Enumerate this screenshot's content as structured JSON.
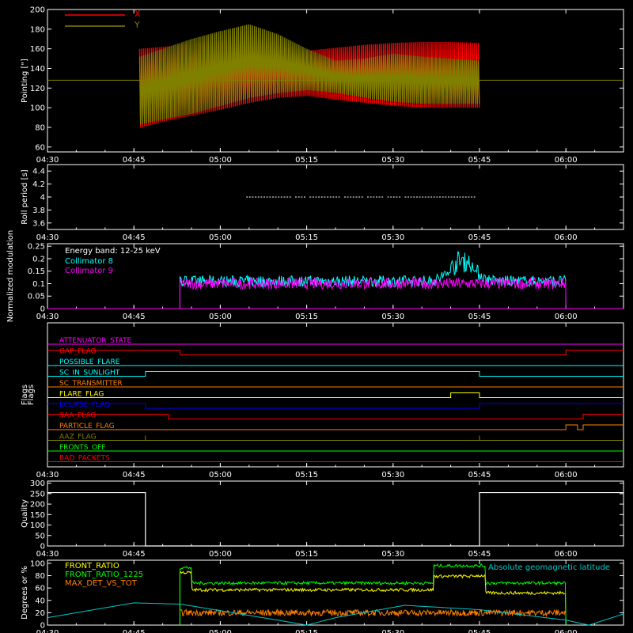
{
  "time_axis": {
    "tick_labels": [
      "04:30",
      "04:45",
      "05:00",
      "05:15",
      "05:30",
      "05:45",
      "06:00"
    ],
    "start": "04:30",
    "end": "06:10"
  },
  "colors": {
    "background": "#000000",
    "axes": "#ffffff",
    "red": "#ff0000",
    "olive": "#808000",
    "cyan": "#00ffff",
    "magenta": "#ff00ff",
    "yellow": "#ffff00",
    "green": "#00ff00",
    "orange": "#ff8000",
    "blue": "#0000ff",
    "dark_red": "#d00000"
  },
  "chart_data": [
    {
      "id": "pointing",
      "type": "line",
      "ylabel": "Pointing [\"]",
      "ylim": [
        55,
        200
      ],
      "yticks": [
        60,
        80,
        100,
        120,
        140,
        160,
        180,
        200
      ],
      "legend_position": "top-left",
      "series": [
        {
          "name": "X",
          "color": "#ff0000",
          "envelope": {
            "x": [
              "04:46",
              "04:50",
              "04:55",
              "05:00",
              "05:05",
              "05:10",
              "05:15",
              "05:20",
              "05:25",
              "05:30",
              "05:35",
              "05:40",
              "05:45"
            ],
            "upper": [
              160,
              162,
              165,
              168,
              167,
              162,
              158,
              161,
              164,
              166,
              167,
              167,
              166
            ],
            "lower": [
              80,
              86,
              92,
              98,
              105,
              110,
              112,
              108,
              105,
              102,
              100,
              100,
              100
            ]
          }
        },
        {
          "name": "Y",
          "color": "#808000",
          "constant": 128,
          "envelope": {
            "x": [
              "04:46",
              "04:50",
              "04:55",
              "05:00",
              "05:05",
              "05:10",
              "05:15",
              "05:20",
              "05:25",
              "05:30",
              "05:35",
              "05:40",
              "05:45"
            ],
            "upper": [
              152,
              160,
              170,
              178,
              185,
              175,
              160,
              148,
              150,
              155,
              152,
              150,
              148
            ],
            "lower": [
              83,
              88,
              94,
              102,
              110,
              115,
              118,
              115,
              110,
              106,
              104,
              104,
              104
            ]
          }
        }
      ]
    },
    {
      "id": "roll_period",
      "type": "line",
      "ylabel": "Roll period [s]",
      "ylim": [
        3.5,
        4.5
      ],
      "yticks": [
        3.6,
        3.8,
        4.0,
        4.2,
        4.4
      ],
      "series": [
        {
          "name": "roll",
          "color": "#ffffff",
          "x_range": [
            "05:04",
            "05:44"
          ],
          "value": 4.0
        }
      ]
    },
    {
      "id": "modulation",
      "type": "line",
      "ylabel": "Normalized modulation",
      "ylim": [
        0,
        0.26
      ],
      "yticks": [
        0.0,
        0.05,
        0.1,
        0.15,
        0.2,
        0.25
      ],
      "legend_position": "top-left",
      "annotation": "Energy band: 12-25 keV",
      "series": [
        {
          "name": "Collimator 8",
          "color": "#00ffff",
          "x_range": [
            "04:53",
            "06:00"
          ],
          "mean": 0.11,
          "peak": {
            "x": "05:42",
            "y": 0.22
          }
        },
        {
          "name": "Collimator 9",
          "color": "#ff00ff",
          "x_range": [
            "04:53",
            "06:00"
          ],
          "mean": 0.1
        }
      ]
    },
    {
      "id": "flags",
      "type": "line",
      "ylabel": "Flags",
      "series": [
        {
          "name": "ATTENUATOR_STATE",
          "color": "#ff00ff",
          "segments": [
            [
              "04:30",
              "06:10",
              0
            ]
          ]
        },
        {
          "name": "GAP_FLAG",
          "color": "#ff0000",
          "segments": [
            [
              "04:30",
              "04:53",
              1
            ],
            [
              "04:53",
              "06:00",
              0
            ],
            [
              "06:00",
              "06:10",
              1
            ]
          ]
        },
        {
          "name": "POSSIBLE_FLARE",
          "color": "#00ffff",
          "segments": [
            [
              "04:30",
              "06:10",
              0
            ]
          ]
        },
        {
          "name": "SC_IN_SUNLIGHT",
          "color": "#00ffff",
          "segments": [
            [
              "04:30",
              "04:47",
              0
            ],
            [
              "04:47",
              "05:45",
              1
            ],
            [
              "05:45",
              "06:10",
              0
            ]
          ]
        },
        {
          "name": "SC_TRANSMITTER",
          "color": "#ff8000",
          "segments": [
            [
              "04:30",
              "06:10",
              0
            ]
          ]
        },
        {
          "name": "FLARE_FLAG",
          "color": "#ffff00",
          "segments": [
            [
              "04:30",
              "05:40",
              0
            ],
            [
              "05:40",
              "05:45",
              1
            ],
            [
              "05:45",
              "06:10",
              0
            ]
          ]
        },
        {
          "name": "ECLIPSE_FLAG",
          "color": "#0000ff",
          "segments": [
            [
              "04:30",
              "04:47",
              1
            ],
            [
              "04:47",
              "05:45",
              0
            ],
            [
              "05:45",
              "06:10",
              1
            ]
          ]
        },
        {
          "name": "SAA_FLAG",
          "color": "#ff0000",
          "segments": [
            [
              "04:30",
              "04:51",
              1
            ],
            [
              "04:51",
              "06:03",
              0
            ],
            [
              "06:03",
              "06:10",
              1
            ]
          ]
        },
        {
          "name": "PARTICLE_FLAG",
          "color": "#ff8000",
          "segments": [
            [
              "04:30",
              "06:00",
              0
            ],
            [
              "06:00",
              "06:02",
              1
            ],
            [
              "06:02",
              "06:03",
              0
            ],
            [
              "06:03",
              "06:10",
              1
            ]
          ]
        },
        {
          "name": "AAZ_FLAG",
          "color": "#808000",
          "segments": [
            [
              "04:30",
              "06:10",
              0
            ]
          ],
          "spikes": [
            "04:47",
            "05:45"
          ]
        },
        {
          "name": "FRONTS_OFF",
          "color": "#00ff00",
          "segments": [
            [
              "04:30",
              "06:10",
              0
            ]
          ]
        },
        {
          "name": "BAD_PACKETS",
          "color": "#ff0000",
          "segments": [
            [
              "04:30",
              "06:10",
              0
            ]
          ]
        }
      ]
    },
    {
      "id": "quality",
      "type": "line",
      "ylabel": "Quality",
      "ylim": [
        0,
        310
      ],
      "yticks": [
        0,
        50,
        100,
        150,
        200,
        250,
        300
      ],
      "series": [
        {
          "name": "quality",
          "color": "#ffffff",
          "segments": [
            [
              "04:30",
              "04:47",
              255
            ],
            [
              "04:47",
              "05:45",
              0
            ],
            [
              "05:45",
              "06:10",
              255
            ]
          ]
        }
      ]
    },
    {
      "id": "ratios",
      "type": "line",
      "ylabel": "Degrees or %",
      "ylim": [
        0,
        105
      ],
      "yticks": [
        0,
        20,
        40,
        60,
        80,
        100
      ],
      "legend_position": "top-left",
      "annotation": "Absolute geomagnetic latitude",
      "series": [
        {
          "name": "FRONT_RATIO",
          "color": "#ffff00",
          "x_range": [
            "04:53",
            "06:00"
          ],
          "segments": [
            [
              "04:53",
              "04:55",
              85
            ],
            [
              "04:55",
              "05:37",
              57
            ],
            [
              "05:37",
              "05:44",
              79
            ],
            [
              "05:44",
              "05:46",
              80
            ],
            [
              "05:46",
              "06:00",
              52
            ]
          ]
        },
        {
          "name": "FRONT_RATIO_1225",
          "color": "#00ff00",
          "x_range": [
            "04:53",
            "06:00"
          ],
          "segments": [
            [
              "04:53",
              "04:55",
              93
            ],
            [
              "04:55",
              "05:37",
              68
            ],
            [
              "05:37",
              "05:46",
              96
            ],
            [
              "05:46",
              "06:00",
              68
            ]
          ]
        },
        {
          "name": "MAX_DET_VS_TOT",
          "color": "#ff8000",
          "x_range": [
            "04:53",
            "06:00"
          ],
          "mean": 20
        },
        {
          "name": "Absolute geomagnetic latitude",
          "color": "#00c8c8",
          "x": [
            "04:30",
            "04:45",
            "04:53",
            "05:10",
            "05:15",
            "05:20",
            "05:32",
            "05:45",
            "06:00",
            "06:04",
            "06:10"
          ],
          "y": [
            12,
            36,
            34,
            8,
            0,
            12,
            32,
            25,
            8,
            0,
            18
          ]
        }
      ]
    }
  ]
}
